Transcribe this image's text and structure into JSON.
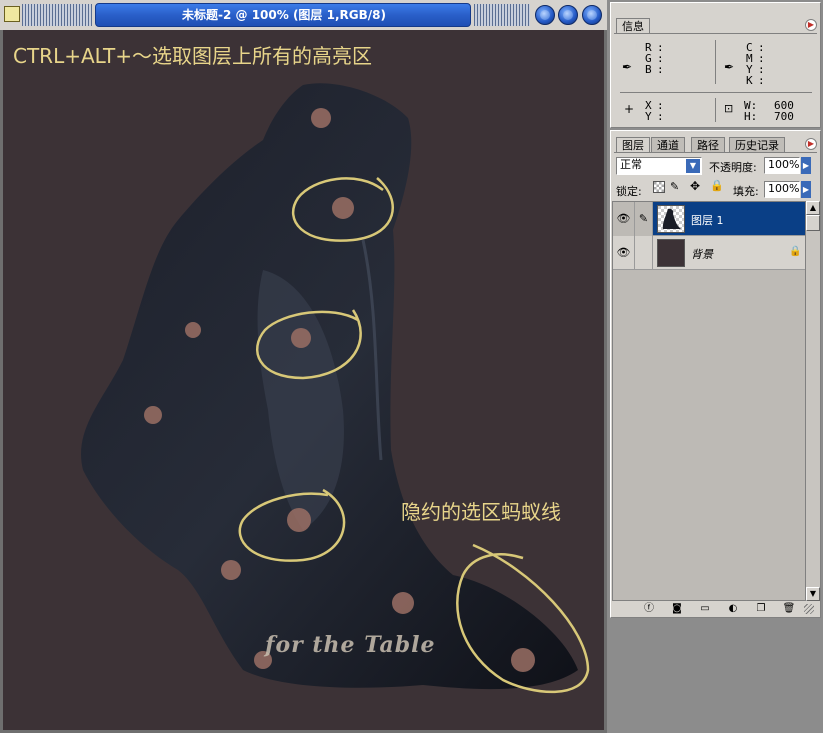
{
  "document": {
    "title": "未标题-2 @ 100% (图层 1,RGB/8)",
    "annotation_top": "CTRL+ALT+～选取图层上所有的高亮区",
    "annotation_right": "隐约的选区蚂蚁线",
    "watermark": "for the Table"
  },
  "info_panel": {
    "tab": "信息",
    "rgb_labels": [
      "R",
      "G",
      "B"
    ],
    "cmyk_labels": [
      "C",
      "M",
      "Y",
      "K"
    ],
    "xy_labels": [
      "X",
      "Y"
    ],
    "w_label": "W",
    "h_label": "H",
    "w_value": "600",
    "h_value": "700"
  },
  "layers_panel": {
    "tabs": [
      "图层",
      "通道",
      "路径",
      "历史记录"
    ],
    "blend_mode": "正常",
    "opacity_label": "不透明度:",
    "opacity_value": "100%",
    "lock_label": "锁定:",
    "fill_label": "填充:",
    "fill_value": "100%",
    "layers": [
      {
        "name": "图层 1",
        "selected": true
      },
      {
        "name": "背景",
        "selected": false
      }
    ]
  },
  "colors": {
    "selected_layer": "#0a3f86",
    "annotation": "#e8d58a",
    "canvas_bg": "#3c3236"
  }
}
